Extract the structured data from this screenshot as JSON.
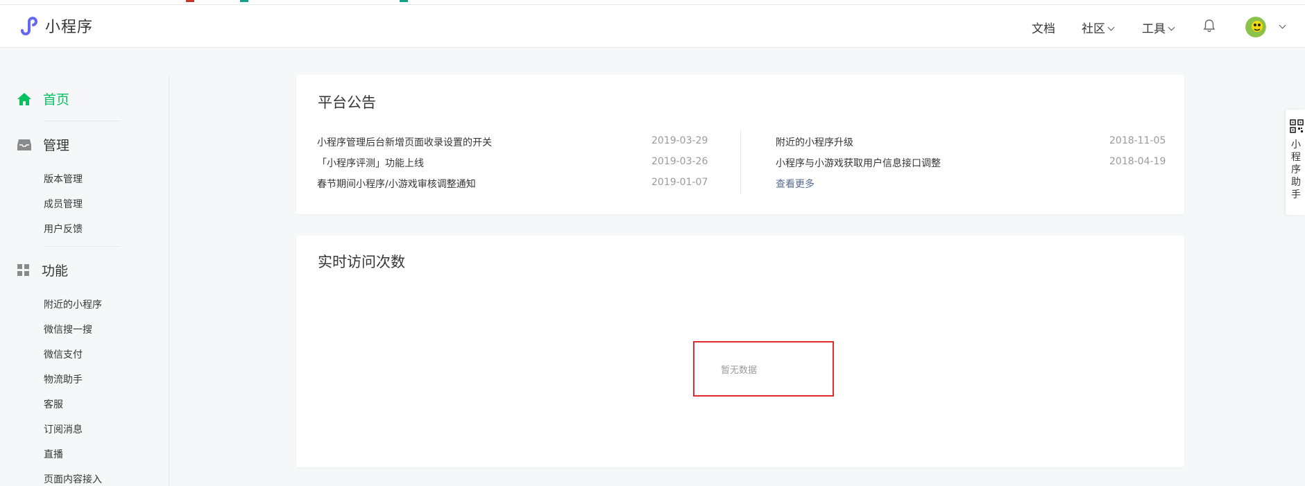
{
  "app": {
    "title": "小程序"
  },
  "nav": {
    "docs": "文档",
    "community": "社区",
    "tools": "工具"
  },
  "sidebar": {
    "home": "首页",
    "manage": {
      "label": "管理",
      "items": [
        "版本管理",
        "成员管理",
        "用户反馈"
      ]
    },
    "features": {
      "label": "功能",
      "items": [
        "附近的小程序",
        "微信搜一搜",
        "微信支付",
        "物流助手",
        "客服",
        "订阅消息",
        "直播",
        "页面内容接入"
      ]
    }
  },
  "announcements": {
    "title": "平台公告",
    "left": [
      {
        "text": "小程序管理后台新增页面收录设置的开关",
        "date": "2019-03-29"
      },
      {
        "text": "「小程序评测」功能上线",
        "date": "2019-03-26"
      },
      {
        "text": "春节期间小程序/小游戏审核调整通知",
        "date": "2019-01-07"
      }
    ],
    "right": [
      {
        "text": "附近的小程序升级",
        "date": "2018-11-05"
      },
      {
        "text": "小程序与小游戏获取用户信息接口调整",
        "date": "2018-04-19"
      }
    ],
    "more": "查看更多"
  },
  "realtime": {
    "title": "实时访问次数",
    "empty": "暂无数据"
  },
  "helper": {
    "label": "小程序助手"
  },
  "colors": {
    "accent": "#07c160",
    "link": "#576b95",
    "highlight": "#e02b2b"
  },
  "icons": {
    "logo": "miniprogram-logo-icon",
    "home": "home-icon",
    "manage": "inbox-icon",
    "features": "grid-icon",
    "bell": "bell-icon",
    "qr": "qr-code-icon"
  }
}
